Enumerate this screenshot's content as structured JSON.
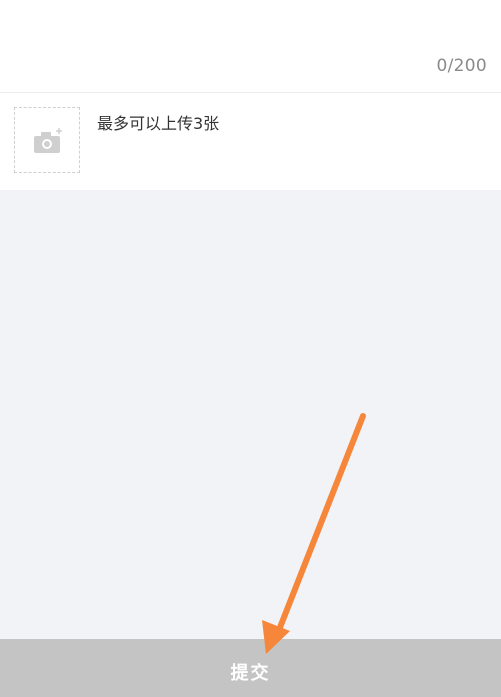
{
  "feedback": {
    "char_counter": "0/200"
  },
  "upload": {
    "hint": "最多可以上传3张",
    "icon": "camera-add-icon"
  },
  "submit": {
    "label": "提交"
  },
  "colors": {
    "background": "#f2f3f7",
    "submit_bar": "#c4c4c4",
    "annotation_arrow": "#f5863a"
  }
}
